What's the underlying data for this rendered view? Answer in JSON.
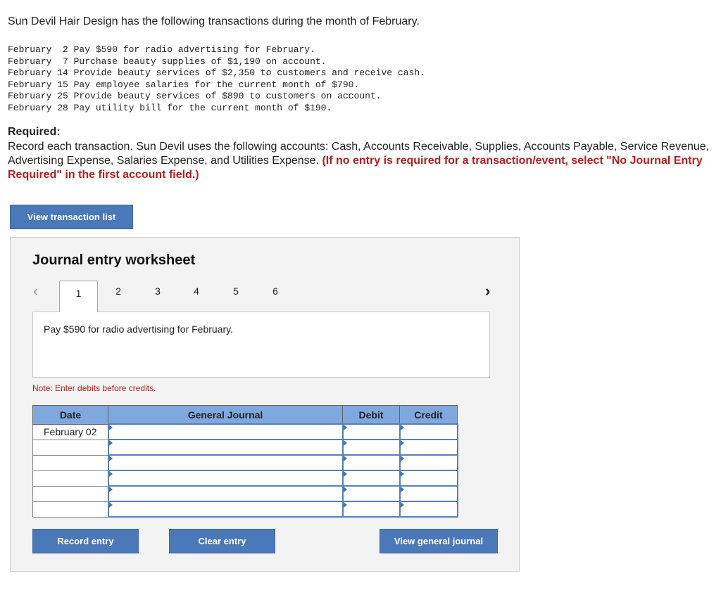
{
  "intro": "Sun Devil Hair Design has the following transactions during the month of February.",
  "transactions": [
    "February  2 Pay $590 for radio advertising for February.",
    "February  7 Purchase beauty supplies of $1,190 on account.",
    "February 14 Provide beauty services of $2,350 to customers and receive cash.",
    "February 15 Pay employee salaries for the current month of $790.",
    "February 25 Provide beauty services of $890 to customers on account.",
    "February 28 Pay utility bill for the current month of $190."
  ],
  "required_heading": "Required:",
  "required_text": "Record each transaction. Sun Devil uses the following accounts: Cash, Accounts Receivable, Supplies, Accounts Payable, Service Revenue, Advertising Expense, Salaries Expense, and Utilities Expense. ",
  "required_note": "(If no entry is required for a transaction/event, select \"No Journal Entry Required\" in the first account field.)",
  "view_transaction_list": "View transaction list",
  "worksheet": {
    "title": "Journal entry worksheet",
    "tabs": [
      "1",
      "2",
      "3",
      "4",
      "5",
      "6"
    ],
    "active_tab": "1",
    "description": "Pay $590 for radio advertising for February.",
    "note": "Note: Enter debits before credits.",
    "columns": [
      "Date",
      "General Journal",
      "Debit",
      "Credit"
    ],
    "rows": [
      {
        "date": "February 02"
      },
      {
        "date": ""
      },
      {
        "date": ""
      },
      {
        "date": ""
      },
      {
        "date": ""
      },
      {
        "date": ""
      }
    ],
    "buttons": {
      "record": "Record entry",
      "clear": "Clear entry",
      "view_journal": "View general journal"
    }
  },
  "colors": {
    "button": "#4a78b8",
    "header": "#7fa8de",
    "note_red": "#b41f1f"
  }
}
